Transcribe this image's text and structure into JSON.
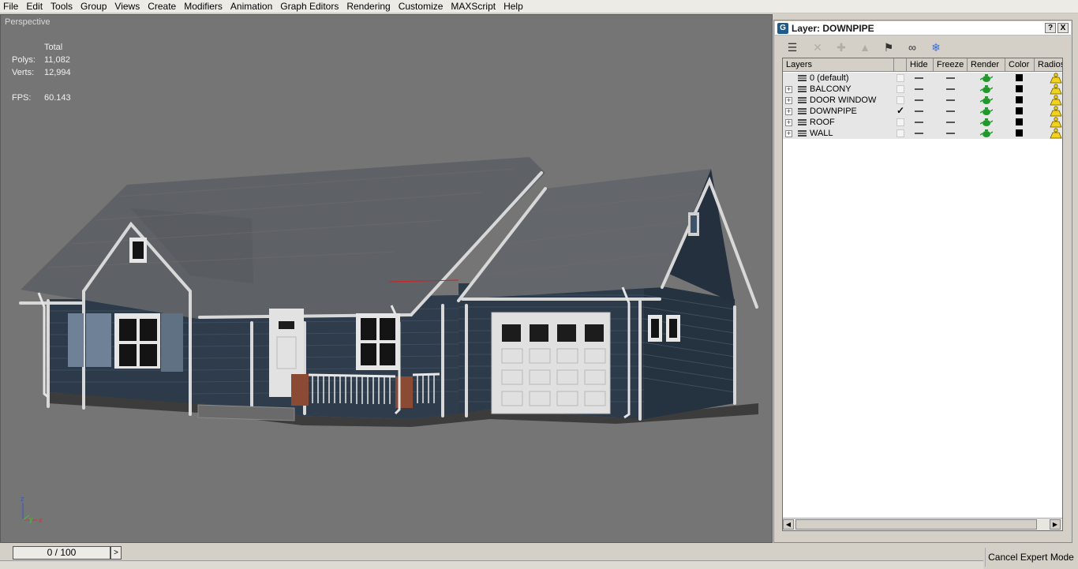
{
  "menu": [
    "File",
    "Edit",
    "Tools",
    "Group",
    "Views",
    "Create",
    "Modifiers",
    "Animation",
    "Graph Editors",
    "Rendering",
    "Customize",
    "MAXScript",
    "Help"
  ],
  "viewport": {
    "label": "Perspective",
    "stats": {
      "header": "Total",
      "polys_label": "Polys:",
      "polys_value": "11,082",
      "verts_label": "Verts:",
      "verts_value": "12,994",
      "fps_label": "FPS:",
      "fps_value": "60.143"
    },
    "axis": {
      "z": "z",
      "y": "y",
      "x": "x"
    },
    "colors": {
      "background": "#757575",
      "siding": "#2c3a4a",
      "trim": "#d8d8d8",
      "roof": "#5e6166"
    }
  },
  "layer_dialog": {
    "title": "Layer: DOWNPIPE",
    "help_label": "?",
    "close_label": "X",
    "columns": {
      "layers": "Layers",
      "hide": "Hide",
      "freeze": "Freeze",
      "render": "Render",
      "color": "Color",
      "radios": "Radios"
    },
    "layers": [
      {
        "name": "0 (default)",
        "expandable": false,
        "current": false
      },
      {
        "name": "BALCONY",
        "expandable": true,
        "current": false
      },
      {
        "name": "DOOR WINDOW",
        "expandable": true,
        "current": false
      },
      {
        "name": "DOWNPIPE",
        "expandable": true,
        "current": true
      },
      {
        "name": "ROOF",
        "expandable": true,
        "current": false
      },
      {
        "name": "WALL",
        "expandable": true,
        "current": false
      }
    ],
    "toolbar_icons": [
      "new-layer-icon",
      "delete-layer-icon",
      "add-to-layer-icon",
      "select-objects-icon",
      "highlight-icon",
      "hide-all-icon",
      "freeze-all-icon"
    ]
  },
  "timebar": {
    "frame": "0 / 100",
    "next": ">",
    "cancel_expert": "Cancel Expert Mode"
  }
}
